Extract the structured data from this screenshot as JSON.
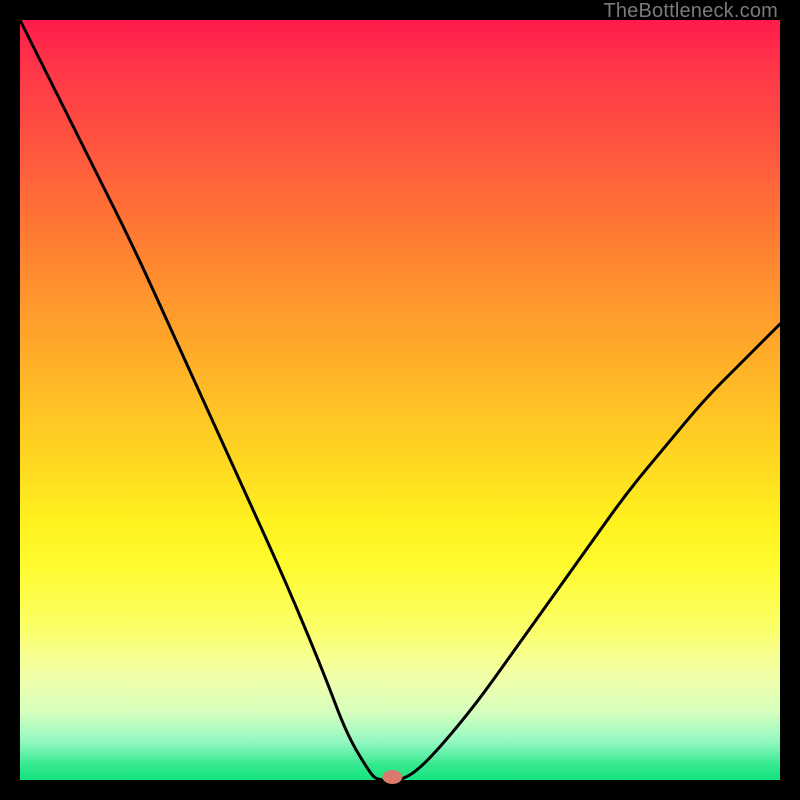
{
  "watermark": "TheBottleneck.com",
  "chart_data": {
    "type": "line",
    "title": "",
    "xlabel": "",
    "ylabel": "",
    "xlim": [
      0,
      100
    ],
    "ylim": [
      0,
      100
    ],
    "grid": false,
    "legend": false,
    "series": [
      {
        "name": "curve",
        "x": [
          0,
          5,
          10,
          15,
          20,
          25,
          30,
          35,
          40,
          43,
          46,
          47,
          49,
          50,
          52,
          55,
          60,
          65,
          70,
          75,
          80,
          85,
          90,
          95,
          100
        ],
        "values": [
          100,
          90,
          80,
          70,
          59,
          48,
          37,
          26,
          14,
          6,
          1,
          0,
          0,
          0,
          1,
          4,
          10,
          17,
          24,
          31,
          38,
          44,
          50,
          55,
          60
        ]
      }
    ],
    "marker": {
      "x": 49,
      "y": 0,
      "color": "#d97a6c"
    }
  }
}
